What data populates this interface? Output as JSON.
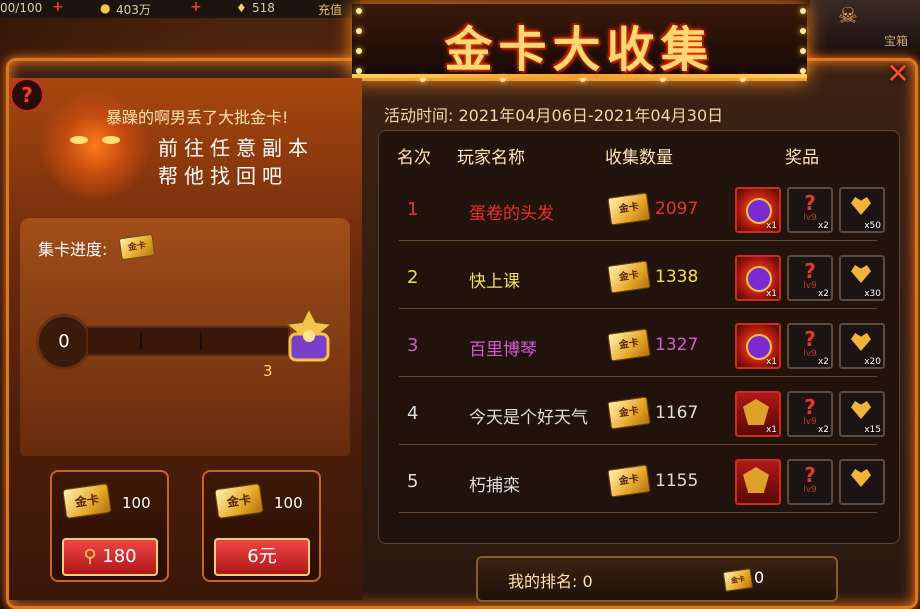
{
  "topbar": {
    "stat1": "00/100",
    "stat2": "403万",
    "stat3": "518",
    "recharge": "充值",
    "treasure": "宝箱"
  },
  "banner": {
    "title": "金卡大收集"
  },
  "left": {
    "story_line1": "暴躁的啊男丢了大批金卡!",
    "story_line2": "前往任意副本",
    "story_line3": "帮他找回吧",
    "progress_label": "集卡进度:",
    "card_text": "金卡",
    "progress_value": "0",
    "trophy_count": "3",
    "buy_options": [
      {
        "card": "金卡",
        "qty": "100",
        "price": "180",
        "price_icon": "gem-icon"
      },
      {
        "card": "金卡",
        "qty": "100",
        "price": "6元"
      }
    ]
  },
  "event": {
    "time_text": "活动时间: 2021年04月06日-2021年04月30日"
  },
  "table": {
    "headers": {
      "rank": "名次",
      "player": "玩家名称",
      "count": "收集数量",
      "prize": "奖品"
    },
    "rows": [
      {
        "rank": "1",
        "player": "蛋卷的头发",
        "count": "2097",
        "color": "#e8322c",
        "prizes": [
          {
            "type": "red",
            "qty": "x1"
          },
          {
            "type": "lv9",
            "qty": "x2"
          },
          {
            "type": "heart",
            "qty": "x50"
          }
        ]
      },
      {
        "rank": "2",
        "player": "快上课",
        "count": "1338",
        "color": "#f2e04a",
        "prizes": [
          {
            "type": "red",
            "qty": "x1"
          },
          {
            "type": "lv9",
            "qty": "x2"
          },
          {
            "type": "heart",
            "qty": "x30"
          }
        ]
      },
      {
        "rank": "3",
        "player": "百里博琴",
        "count": "1327",
        "color": "#d55ad6",
        "prizes": [
          {
            "type": "red",
            "qty": "x1"
          },
          {
            "type": "lv9",
            "qty": "x2"
          },
          {
            "type": "heart",
            "qty": "x20"
          }
        ]
      },
      {
        "rank": "4",
        "player": "今天是个好天气",
        "count": "1167",
        "color": "#dcdcdc",
        "prizes": [
          {
            "type": "badge",
            "qty": "x1"
          },
          {
            "type": "lv9",
            "qty": "x2"
          },
          {
            "type": "heart",
            "qty": "x15"
          }
        ]
      },
      {
        "rank": "5",
        "player": "朽捕栾",
        "count": "1155",
        "color": "#dcdcdc",
        "prizes": [
          {
            "type": "badge",
            "qty": ""
          },
          {
            "type": "lv9",
            "qty": ""
          },
          {
            "type": "heart",
            "qty": ""
          }
        ]
      }
    ],
    "card_text": "金卡"
  },
  "myrank": {
    "label": "我的排名: 0",
    "card_text": "金卡",
    "count": "0"
  }
}
